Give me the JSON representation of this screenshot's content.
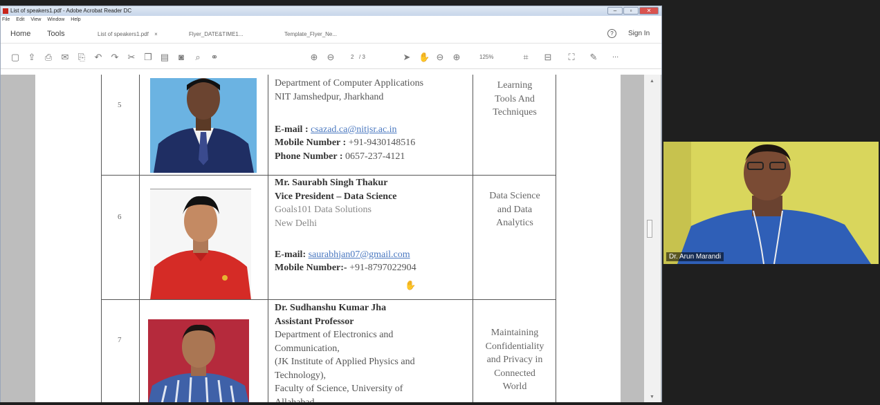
{
  "window": {
    "title": "List of speakers1.pdf - Adobe Acrobat Reader DC",
    "controls": [
      "–",
      "▫",
      "✕"
    ]
  },
  "menu": [
    "File",
    "Edit",
    "View",
    "Window",
    "Help"
  ],
  "tabs": {
    "home": "Home",
    "tools": "Tools",
    "doc_tabs": [
      "List of speakers1.pdf",
      "Flyer_DATE&TIME1...",
      "Template_Flyer_Ne..."
    ],
    "close_glyph": "×",
    "help_glyph": "?",
    "sign_in": "Sign In"
  },
  "toolbar": {
    "page_current": "2",
    "page_total": "/ 3",
    "zoom": "125%",
    "more": "..."
  },
  "speakers": [
    {
      "sno": "5",
      "lines": [
        {
          "t": "Department of Computer Applications",
          "s": "n"
        },
        {
          "t": "NIT Jamshedpur, Jharkhand",
          "s": "n"
        },
        {
          "t": "",
          "s": "n"
        },
        {
          "t": "E-mail : ",
          "s": "b",
          "link": "csazad.ca@nitjsr.ac.in"
        },
        {
          "t": "Mobile Number : ",
          "s": "b",
          "rest": "+91-9430148516"
        },
        {
          "t": "Phone Number : ",
          "s": "b",
          "rest": "0657-237-4121"
        }
      ],
      "topic": [
        "Learning",
        "Tools And",
        "Techniques"
      ]
    },
    {
      "sno": "6",
      "lines": [
        {
          "t": "Mr. Saurabh Singh Thakur",
          "s": "b"
        },
        {
          "t": "Vice President – Data Science",
          "s": "b"
        },
        {
          "t": "Goals101 Data Solutions",
          "s": "g"
        },
        {
          "t": "New Delhi",
          "s": "g"
        },
        {
          "t": "",
          "s": "n"
        },
        {
          "t": "E-mail: ",
          "s": "b",
          "link": "saurabhjan07@gmail.com"
        },
        {
          "t": "Mobile Number:- ",
          "s": "b",
          "rest": "+91-8797022904"
        }
      ],
      "topic": [
        "Data Science",
        "and Data",
        "Analytics"
      ]
    },
    {
      "sno": "7",
      "lines": [
        {
          "t": "Dr. Sudhanshu Kumar Jha",
          "s": "b"
        },
        {
          "t": "Assistant Professor",
          "s": "b"
        },
        {
          "t": "Department of Electronics and",
          "s": "n"
        },
        {
          "t": "Communication,",
          "s": "n"
        },
        {
          "t": "(JK Institute of Applied Physics and",
          "s": "n"
        },
        {
          "t": "Technology),",
          "s": "n"
        },
        {
          "t": "Faculty of Science, University of",
          "s": "n"
        },
        {
          "t": "Allahabad,",
          "s": "n"
        }
      ],
      "topic": [
        "Maintaining",
        "Confidentiality",
        "and Privacy in",
        "Connected",
        "World"
      ]
    }
  ],
  "participant": {
    "name": "Dr. Arun Marandi"
  },
  "colors": {
    "acrobat_red": "#c8251b",
    "link_blue": "#4a78c0",
    "video_bg": "#dcd85f",
    "shirt_blue": "#2f5fb7"
  }
}
